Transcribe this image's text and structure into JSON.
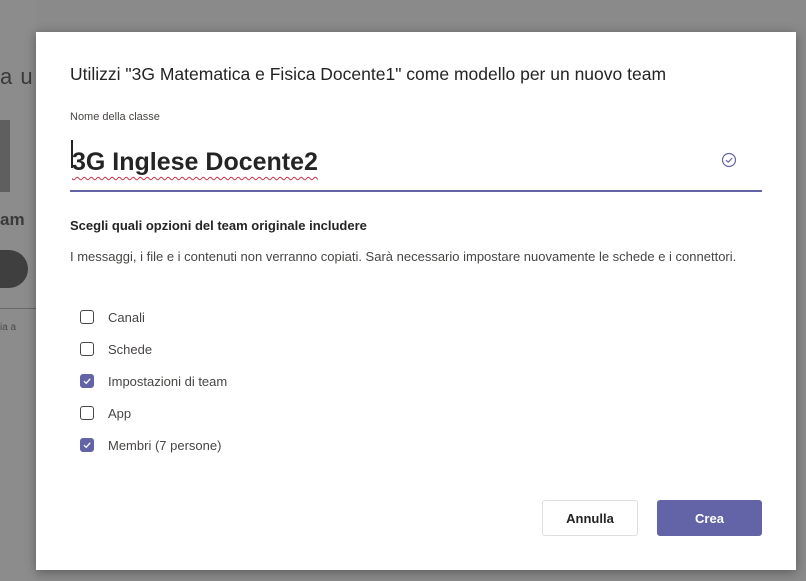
{
  "background": {
    "fragment_1": "a u",
    "fragment_2": "am",
    "fragment_3": "ia a"
  },
  "dialog": {
    "title": "Utilizzi \"3G Matematica e Fisica Docente1\" come modello per un nuovo team",
    "name_field": {
      "label": "Nome della classe",
      "value": "3G Inglese Docente2",
      "status_icon": "check-circle-icon"
    },
    "options_section": {
      "title": "Scegli quali opzioni del team originale includere",
      "description": "I messaggi, i file e i contenuti non verranno copiati. Sarà necessario impostare nuovamente le schede e i connettori.",
      "options": [
        {
          "label": "Canali",
          "checked": false
        },
        {
          "label": "Schede",
          "checked": false
        },
        {
          "label": "Impostazioni di team",
          "checked": true
        },
        {
          "label": "App",
          "checked": false
        },
        {
          "label": "Membri (7 persone)",
          "checked": true
        }
      ]
    },
    "buttons": {
      "cancel": "Annulla",
      "create": "Crea"
    }
  },
  "colors": {
    "accent": "#6264a7",
    "overlay": "#8a8a8a"
  }
}
